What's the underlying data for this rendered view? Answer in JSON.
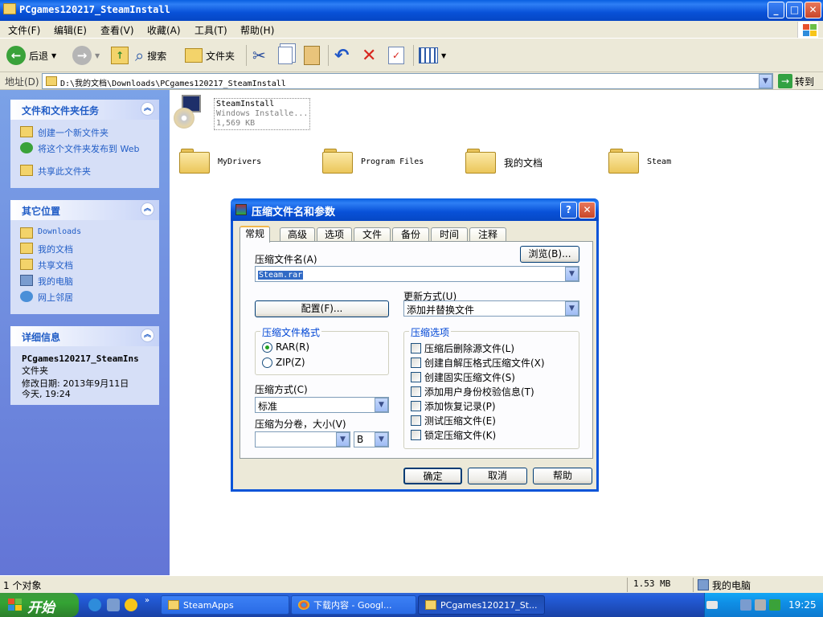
{
  "window": {
    "title": "PCgames120217_SteamInstall",
    "controls": {
      "minimize": "_",
      "maximize": "□",
      "close": "✕"
    }
  },
  "menu": [
    "文件(F)",
    "编辑(E)",
    "查看(V)",
    "收藏(A)",
    "工具(T)",
    "帮助(H)"
  ],
  "toolbar": {
    "back": "后退",
    "search": "搜索",
    "folders": "文件夹"
  },
  "address": {
    "label": "地址(D)",
    "path": "D:\\我的文档\\Downloads\\PCgames120217_SteamInstall",
    "go": "转到"
  },
  "tasks_panel": {
    "title": "文件和文件夹任务",
    "links": [
      "创建一个新文件夹",
      "将这个文件夹发布到 Web",
      "共享此文件夹"
    ]
  },
  "places_panel": {
    "title": "其它位置",
    "links": [
      "Downloads",
      "我的文档",
      "共享文档",
      "我的电脑",
      "网上邻居"
    ]
  },
  "details_panel": {
    "title": "详细信息",
    "name": "PCgames120217_SteamIns",
    "type": "文件夹",
    "modified_label": "修改日期: 2013年9月11日",
    "modified_time": "今天, 19:24"
  },
  "files": {
    "installer": {
      "name": "SteamInstall",
      "type": "Windows Installe...",
      "size": "1,569 KB"
    },
    "folders": [
      "MyDrivers",
      "Program Files",
      "我的文档",
      "Steam"
    ]
  },
  "dialog": {
    "title": "压缩文件名和参数",
    "tabs": [
      "常规",
      "高级",
      "选项",
      "文件",
      "备份",
      "时间",
      "注释"
    ],
    "archive_name_label": "压缩文件名(A)",
    "archive_name_value": "Steam.rar",
    "browse_button": "浏览(B)...",
    "update_method_label": "更新方式(U)",
    "update_method_value": "添加并替换文件",
    "profiles_button": "配置(F)...",
    "format_group": "压缩文件格式",
    "format_options": [
      "RAR(R)",
      "ZIP(Z)"
    ],
    "format_selected": "RAR(R)",
    "options_group": "压缩选项",
    "options": [
      "压缩后删除源文件(L)",
      "创建自解压格式压缩文件(X)",
      "创建固实压缩文件(S)",
      "添加用户身份校验信息(T)",
      "添加恢复记录(P)",
      "测试压缩文件(E)",
      "锁定压缩文件(K)"
    ],
    "method_label": "压缩方式(C)",
    "method_value": "标准",
    "split_label": "压缩为分卷，大小(V)",
    "split_value": "",
    "split_unit": "B",
    "ok": "确定",
    "cancel": "取消",
    "help": "帮助"
  },
  "status": {
    "count": "1 个对象",
    "size": "1.53 MB",
    "location": "我的电脑"
  },
  "taskbar": {
    "start": "开始",
    "tasks": [
      "SteamApps",
      "下载内容 - Googl...",
      "PCgames120217_St..."
    ],
    "clock": "19:25"
  },
  "colors": {
    "xp_blue": "#0A54D8",
    "panel_bg": "#D6DFF7",
    "start_green": "#34A334"
  }
}
